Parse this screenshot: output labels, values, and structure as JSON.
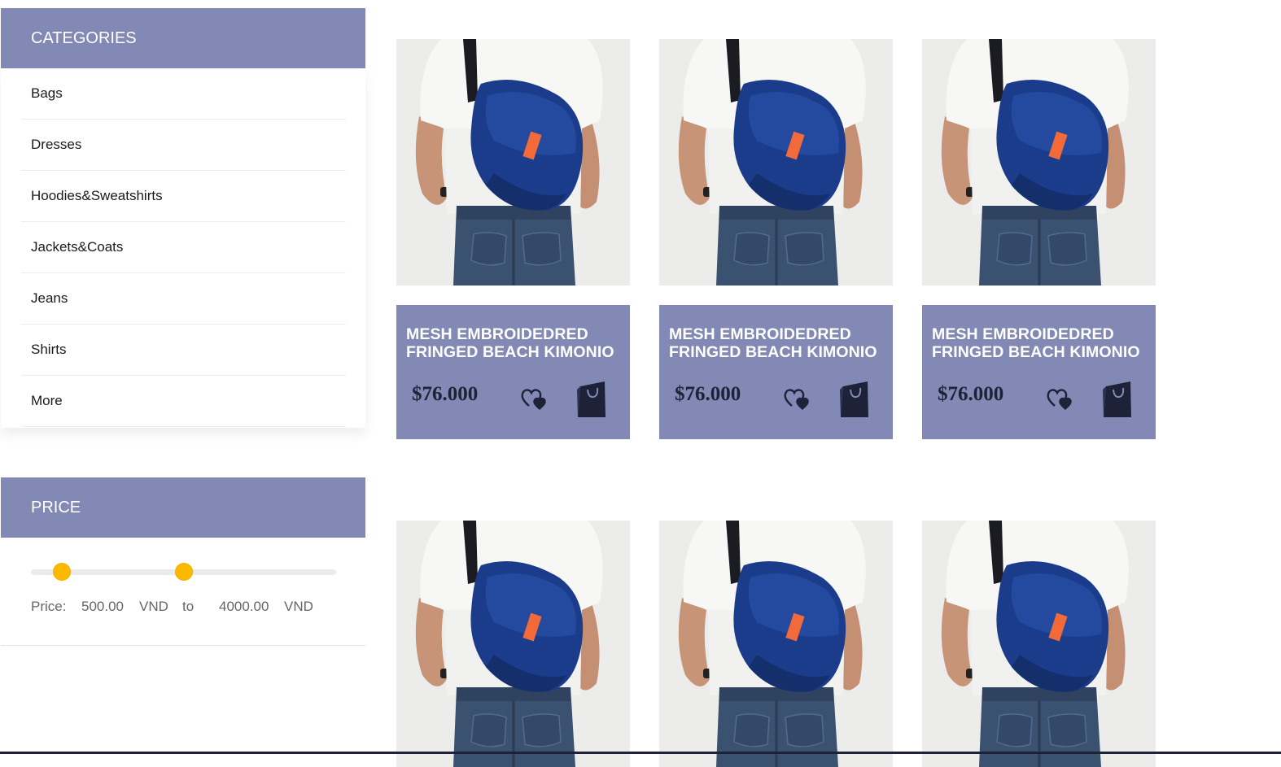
{
  "categories": {
    "title": "CATEGORIES",
    "items": [
      {
        "label": "Bags"
      },
      {
        "label": "Dresses"
      },
      {
        "label": "Hoodies&Sweatshirts"
      },
      {
        "label": "Jackets&Coats"
      },
      {
        "label": "Jeans"
      },
      {
        "label": "Shirts"
      },
      {
        "label": "More"
      }
    ]
  },
  "price_filter": {
    "title": "PRICE",
    "label": "Price:",
    "min_value": "500.00",
    "max_value": "4000.00",
    "currency": "VND",
    "separator": "to",
    "min_fraction": 0.1,
    "max_fraction": 0.5
  },
  "products": [
    {
      "title": "MESH EMBROIDEDRED FRINGED BEACH KIMONIO",
      "price": "$76.000",
      "image": "man-with-messenger-bag-photo",
      "wishlist_icon": "heart-icon",
      "cart_icon": "shopping-bag-icon"
    },
    {
      "title": "MESH EMBROIDEDRED FRINGED BEACH KIMONIO",
      "price": "$76.000",
      "image": "man-with-messenger-bag-photo",
      "wishlist_icon": "heart-icon",
      "cart_icon": "shopping-bag-icon"
    },
    {
      "title": "MESH EMBROIDEDRED FRINGED BEACH KIMONIO",
      "price": "$76.000",
      "image": "man-with-messenger-bag-photo",
      "wishlist_icon": "heart-icon",
      "cart_icon": "shopping-bag-icon"
    },
    {
      "image": "man-with-messenger-bag-photo"
    },
    {
      "image": "man-with-messenger-bag-photo"
    },
    {
      "image": "man-with-messenger-bag-photo"
    }
  ],
  "colors": {
    "accent": "#8189b4",
    "slider_thumb": "#fcb900",
    "icon_dark": "#1d2238"
  }
}
